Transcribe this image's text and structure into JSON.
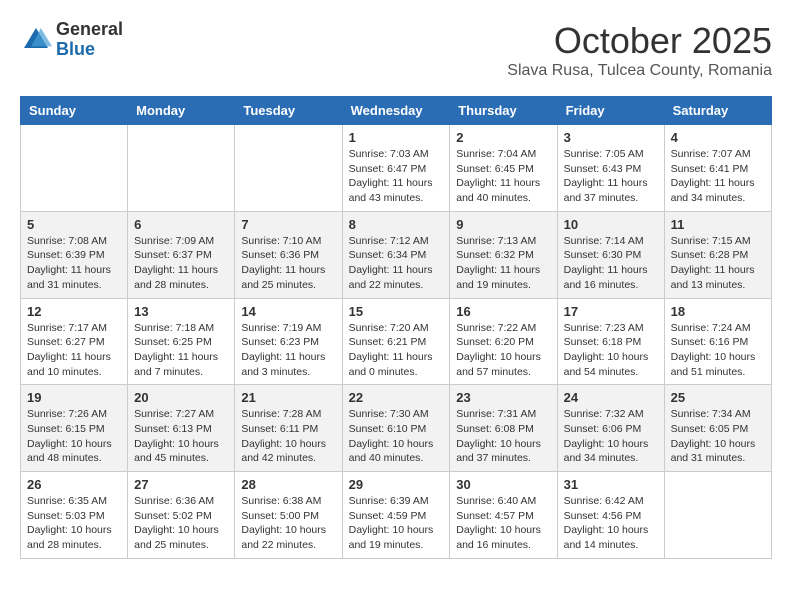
{
  "header": {
    "logo_general": "General",
    "logo_blue": "Blue",
    "title": "October 2025",
    "location": "Slava Rusa, Tulcea County, Romania"
  },
  "weekdays": [
    "Sunday",
    "Monday",
    "Tuesday",
    "Wednesday",
    "Thursday",
    "Friday",
    "Saturday"
  ],
  "weeks": [
    [
      null,
      null,
      null,
      {
        "day": "1",
        "sunrise": "7:03 AM",
        "sunset": "6:47 PM",
        "daylight": "11 hours and 43 minutes."
      },
      {
        "day": "2",
        "sunrise": "7:04 AM",
        "sunset": "6:45 PM",
        "daylight": "11 hours and 40 minutes."
      },
      {
        "day": "3",
        "sunrise": "7:05 AM",
        "sunset": "6:43 PM",
        "daylight": "11 hours and 37 minutes."
      },
      {
        "day": "4",
        "sunrise": "7:07 AM",
        "sunset": "6:41 PM",
        "daylight": "11 hours and 34 minutes."
      }
    ],
    [
      {
        "day": "5",
        "sunrise": "7:08 AM",
        "sunset": "6:39 PM",
        "daylight": "11 hours and 31 minutes."
      },
      {
        "day": "6",
        "sunrise": "7:09 AM",
        "sunset": "6:37 PM",
        "daylight": "11 hours and 28 minutes."
      },
      {
        "day": "7",
        "sunrise": "7:10 AM",
        "sunset": "6:36 PM",
        "daylight": "11 hours and 25 minutes."
      },
      {
        "day": "8",
        "sunrise": "7:12 AM",
        "sunset": "6:34 PM",
        "daylight": "11 hours and 22 minutes."
      },
      {
        "day": "9",
        "sunrise": "7:13 AM",
        "sunset": "6:32 PM",
        "daylight": "11 hours and 19 minutes."
      },
      {
        "day": "10",
        "sunrise": "7:14 AM",
        "sunset": "6:30 PM",
        "daylight": "11 hours and 16 minutes."
      },
      {
        "day": "11",
        "sunrise": "7:15 AM",
        "sunset": "6:28 PM",
        "daylight": "11 hours and 13 minutes."
      }
    ],
    [
      {
        "day": "12",
        "sunrise": "7:17 AM",
        "sunset": "6:27 PM",
        "daylight": "11 hours and 10 minutes."
      },
      {
        "day": "13",
        "sunrise": "7:18 AM",
        "sunset": "6:25 PM",
        "daylight": "11 hours and 7 minutes."
      },
      {
        "day": "14",
        "sunrise": "7:19 AM",
        "sunset": "6:23 PM",
        "daylight": "11 hours and 3 minutes."
      },
      {
        "day": "15",
        "sunrise": "7:20 AM",
        "sunset": "6:21 PM",
        "daylight": "11 hours and 0 minutes."
      },
      {
        "day": "16",
        "sunrise": "7:22 AM",
        "sunset": "6:20 PM",
        "daylight": "10 hours and 57 minutes."
      },
      {
        "day": "17",
        "sunrise": "7:23 AM",
        "sunset": "6:18 PM",
        "daylight": "10 hours and 54 minutes."
      },
      {
        "day": "18",
        "sunrise": "7:24 AM",
        "sunset": "6:16 PM",
        "daylight": "10 hours and 51 minutes."
      }
    ],
    [
      {
        "day": "19",
        "sunrise": "7:26 AM",
        "sunset": "6:15 PM",
        "daylight": "10 hours and 48 minutes."
      },
      {
        "day": "20",
        "sunrise": "7:27 AM",
        "sunset": "6:13 PM",
        "daylight": "10 hours and 45 minutes."
      },
      {
        "day": "21",
        "sunrise": "7:28 AM",
        "sunset": "6:11 PM",
        "daylight": "10 hours and 42 minutes."
      },
      {
        "day": "22",
        "sunrise": "7:30 AM",
        "sunset": "6:10 PM",
        "daylight": "10 hours and 40 minutes."
      },
      {
        "day": "23",
        "sunrise": "7:31 AM",
        "sunset": "6:08 PM",
        "daylight": "10 hours and 37 minutes."
      },
      {
        "day": "24",
        "sunrise": "7:32 AM",
        "sunset": "6:06 PM",
        "daylight": "10 hours and 34 minutes."
      },
      {
        "day": "25",
        "sunrise": "7:34 AM",
        "sunset": "6:05 PM",
        "daylight": "10 hours and 31 minutes."
      }
    ],
    [
      {
        "day": "26",
        "sunrise": "6:35 AM",
        "sunset": "5:03 PM",
        "daylight": "10 hours and 28 minutes."
      },
      {
        "day": "27",
        "sunrise": "6:36 AM",
        "sunset": "5:02 PM",
        "daylight": "10 hours and 25 minutes."
      },
      {
        "day": "28",
        "sunrise": "6:38 AM",
        "sunset": "5:00 PM",
        "daylight": "10 hours and 22 minutes."
      },
      {
        "day": "29",
        "sunrise": "6:39 AM",
        "sunset": "4:59 PM",
        "daylight": "10 hours and 19 minutes."
      },
      {
        "day": "30",
        "sunrise": "6:40 AM",
        "sunset": "4:57 PM",
        "daylight": "10 hours and 16 minutes."
      },
      {
        "day": "31",
        "sunrise": "6:42 AM",
        "sunset": "4:56 PM",
        "daylight": "10 hours and 14 minutes."
      },
      null
    ]
  ]
}
